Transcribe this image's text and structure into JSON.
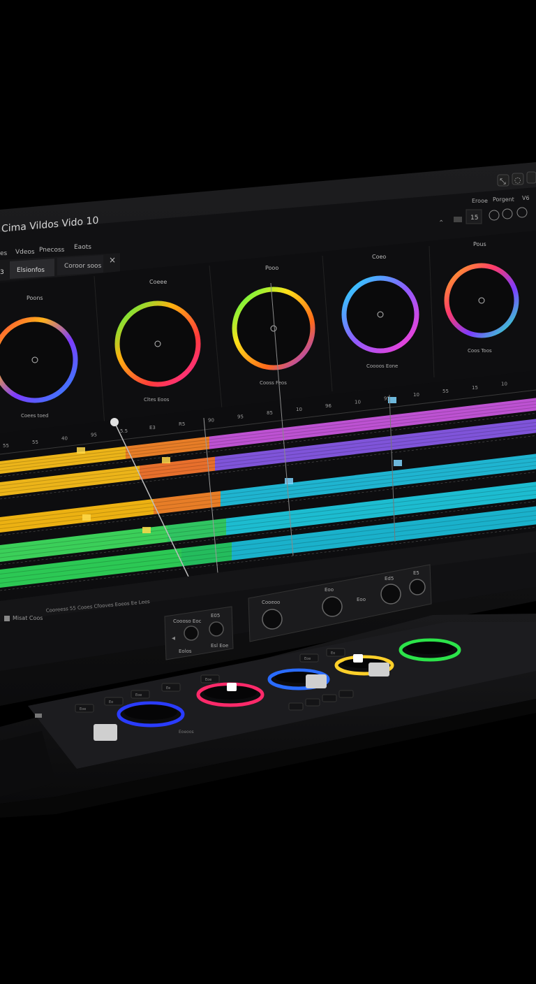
{
  "app": {
    "title": "Cima Vildos Vido 10",
    "menu": [
      "es",
      "Vdeos",
      "Pnecoss",
      "Eaots"
    ],
    "tabs": [
      "3",
      "Elsionfos",
      "Coroor soos"
    ],
    "tab_close": "×",
    "window_controls": [
      "⤡",
      "◌",
      "⌂"
    ],
    "right_menu": [
      "Erooe",
      "Porgent",
      "V6"
    ],
    "toolbar_right": [
      "15"
    ]
  },
  "color_wheels": [
    {
      "label": "Poons",
      "sub": "Coees toed",
      "gradient": "warm"
    },
    {
      "label": "Coeee",
      "sub": "Cltes Eoos",
      "gradient": "warm2"
    },
    {
      "label": "Pooo",
      "sub": "Cooss Feos",
      "gradient": "full"
    },
    {
      "label": "Coeo",
      "sub": "Coooos Eone",
      "gradient": "cool"
    },
    {
      "label": "Pous",
      "sub": "Coos Toos",
      "gradient": "cool2"
    }
  ],
  "timeline": {
    "ruler_labels": [
      "55",
      "55",
      "40",
      "95",
      "5.5",
      "E3",
      "R5",
      "90",
      "95",
      "85",
      "10",
      "96",
      "10",
      "95",
      "10",
      "55",
      "15",
      "10"
    ],
    "tracks": [
      {
        "color": "#ffc21a",
        "accent": "#ff8a2a",
        "end_color": "#d05ae8"
      },
      {
        "color": "#ffc21a",
        "accent": "#ff7a30",
        "end_color": "#8c5cf0"
      },
      {
        "color": "#ffbf12",
        "accent": "#ff8a2a",
        "end_color": "#21c6e6"
      },
      {
        "color": "#3fe060",
        "accent": "#34d86a",
        "end_color": "#1fcfe6"
      },
      {
        "color": "#2fd85a",
        "accent": "#27cf66",
        "end_color": "#1cc3e0"
      }
    ],
    "status_text": "Cooreess  55 Cooes Cfooves Eoeos Ee Lees",
    "status_left": "Misat Coos"
  },
  "control_panel": {
    "left_box": {
      "label1": "Coooso Eoc",
      "label2": "E05",
      "label3": "Eolos",
      "label4": "Esl Eoe"
    },
    "right_box": {
      "label1": "Cooeoo",
      "label2": "Eoo",
      "label3": "Eoo",
      "label4": "Ed5",
      "label5": "E5"
    }
  },
  "console": {
    "keys": [
      "Eoe",
      "Eo",
      "Eoe",
      "Ee",
      "Eoe",
      "Eoe",
      "Eo"
    ],
    "ring_colors": [
      "#2a3cff",
      "#ff2a6a",
      "#2a6cff",
      "#ffd02a",
      "#2ce34a"
    ],
    "label": "Eoeoos"
  }
}
